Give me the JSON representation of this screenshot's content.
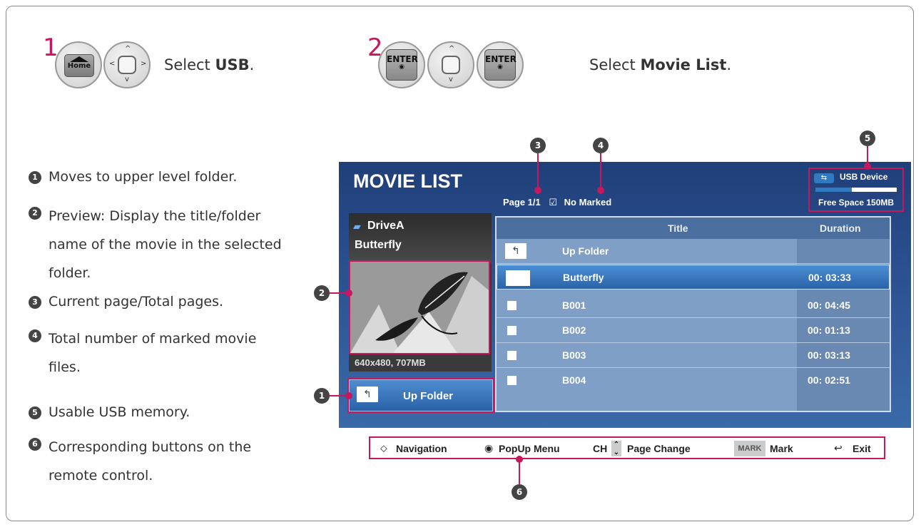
{
  "steps": [
    {
      "number": "1",
      "instruction_prefix": "Select ",
      "instruction_bold": "USB",
      "instruction_suffix": ".",
      "key_label": "Home"
    },
    {
      "number": "2",
      "instruction_prefix": "Select ",
      "instruction_bold": "Movie List",
      "instruction_suffix": ".",
      "key_label": "ENTER"
    }
  ],
  "legend": [
    {
      "num": "1",
      "text": "Moves to upper level folder."
    },
    {
      "num": "2",
      "text": "Preview: Display the title/folder name of the movie in the selected folder."
    },
    {
      "num": "3",
      "text": "Current page/Total pages."
    },
    {
      "num": "4",
      "text": "Total number of marked movie files."
    },
    {
      "num": "5",
      "text": "Usable USB memory."
    },
    {
      "num": "6",
      "text": "Corresponding buttons on the remote control."
    }
  ],
  "screen": {
    "title": "MOVIE LIST",
    "page": "Page 1/1",
    "marked": "No Marked",
    "usb_label": "USB Device",
    "free_space": "Free Space 150MB",
    "usb_fill": 0.45,
    "preview": {
      "drive": "DriveA",
      "name": "Butterfly",
      "info": "640x480, 707MB"
    },
    "up_folder_button": "Up Folder",
    "table": {
      "headers": {
        "title": "Title",
        "duration": "Duration"
      },
      "rows": [
        {
          "title": "Up Folder",
          "duration": ""
        },
        {
          "title": "Butterfly",
          "duration": "00: 03:33"
        },
        {
          "title": "B001",
          "duration": "00: 04:45"
        },
        {
          "title": "B002",
          "duration": "00: 01:13"
        },
        {
          "title": "B003",
          "duration": "00: 03:13"
        },
        {
          "title": "B004",
          "duration": "00: 02:51"
        }
      ]
    }
  },
  "bottom_bar": {
    "navigation": "Navigation",
    "popup": "PopUp Menu",
    "ch": "CH",
    "page_change": "Page Change",
    "mark_key": "MARK",
    "mark": "Mark",
    "exit": "Exit"
  },
  "callouts": [
    "1",
    "2",
    "3",
    "4",
    "5",
    "6"
  ],
  "colors": {
    "accent": "#c8175d",
    "screen_bg": "#2b4f8f",
    "selected_row": "#2f6fb8"
  }
}
